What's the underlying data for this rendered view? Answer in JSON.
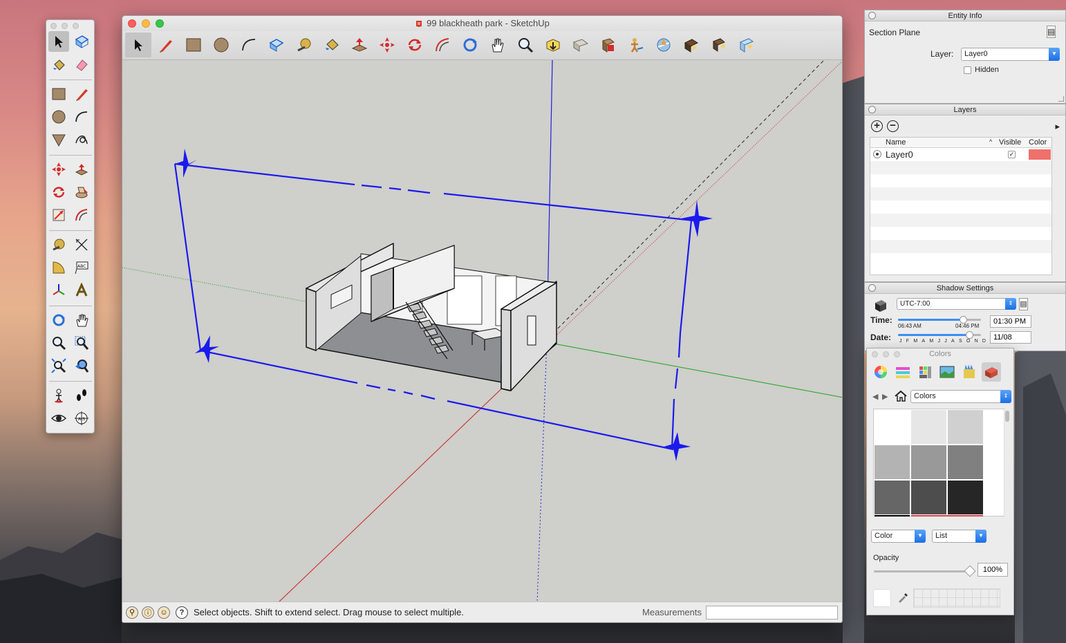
{
  "main_window": {
    "title": "99 blackheath park - SketchUp"
  },
  "status_bar": {
    "message": "Select objects. Shift to extend select. Drag mouse to select multiple.",
    "measurements_label": "Measurements",
    "measurements_value": ""
  },
  "entity_info": {
    "panel_title": "Entity Info",
    "entity_type": "Section Plane",
    "layer_label": "Layer:",
    "layer_value": "Layer0",
    "hidden_label": "Hidden",
    "hidden_checked": false
  },
  "layers": {
    "panel_title": "Layers",
    "columns": [
      "Name",
      "Visible",
      "Color"
    ],
    "rows": [
      {
        "name": "Layer0",
        "visible": true,
        "color": "#f0706c",
        "active": true
      }
    ]
  },
  "shadow_settings": {
    "panel_title": "Shadow Settings",
    "timezone": "UTC-7:00",
    "time_label": "Time:",
    "time_start": "06:43 AM",
    "time_end": "04:46 PM",
    "time_value": "01:30 PM",
    "time_slider_fraction": 0.78,
    "date_label": "Date:",
    "months": [
      "J",
      "F",
      "M",
      "A",
      "M",
      "J",
      "J",
      "A",
      "S",
      "O",
      "N",
      "D"
    ],
    "date_value": "11/08",
    "date_slider_fraction": 0.86
  },
  "colors_panel": {
    "title": "Colors",
    "palette_select": "Colors",
    "mode_select": "Color",
    "view_select": "List",
    "opacity_label": "Opacity",
    "opacity_value": "100%",
    "swatches": [
      "#ffffff",
      "#e6e6e6",
      "#d0d0d0",
      "#b3b3b3",
      "#999999",
      "#808080",
      "#666666",
      "#4d4d4d",
      "#262626"
    ]
  },
  "colors": {
    "x_axis": "#e0201c",
    "y_axis": "#1aa31a",
    "z_axis": "#1f1fd8",
    "section_plane": "#1a1aee",
    "viewport_bg": "#cfcfcb"
  },
  "icons": {
    "toolbar": [
      "select-icon",
      "pencil-icon",
      "rectangle-icon",
      "circle-icon",
      "arc-icon",
      "paint-bucket-icon",
      "tape-measure-icon",
      "eraser-icon",
      "push-pull-icon",
      "move-icon",
      "rotate-icon",
      "follow-me-icon",
      "orbit-icon",
      "pan-icon",
      "zoom-icon",
      "zoom-extents-icon",
      "section-plane-icon",
      "warehouse-icon",
      "position-camera-icon",
      "walk-icon",
      "extension-warehouse-icon",
      "share-model-icon",
      "send-to-layout-icon"
    ]
  }
}
